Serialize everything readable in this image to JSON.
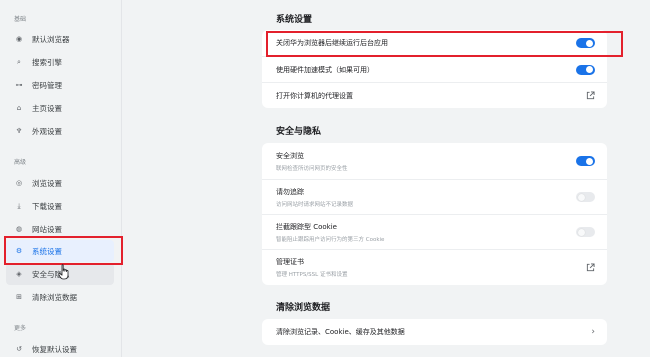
{
  "sidebar": {
    "sections": [
      {
        "label": "基础",
        "items": [
          {
            "icon": "chrome-logo-icon",
            "glyph": "◉",
            "label": "默认浏览器"
          },
          {
            "icon": "search-icon",
            "glyph": "⌕",
            "label": "搜索引擎"
          },
          {
            "icon": "key-icon",
            "glyph": "⊶",
            "label": "密码管理"
          },
          {
            "icon": "home-icon",
            "glyph": "⌂",
            "label": "主页设置"
          },
          {
            "icon": "brush-icon",
            "glyph": "♆",
            "label": "外观设置"
          }
        ]
      },
      {
        "label": "高级",
        "items": [
          {
            "icon": "eye-icon",
            "glyph": "◎",
            "label": "浏览设置"
          },
          {
            "icon": "download-icon",
            "glyph": "⤓",
            "label": "下载设置"
          },
          {
            "icon": "globe-icon",
            "glyph": "◍",
            "label": "网站设置"
          },
          {
            "icon": "gear-icon",
            "glyph": "⚙",
            "label": "系统设置"
          },
          {
            "icon": "shield-icon",
            "glyph": "◈",
            "label": "安全与隐私"
          },
          {
            "icon": "trash-icon",
            "glyph": "⊞",
            "label": "清除浏览数据"
          }
        ]
      },
      {
        "label": "更多",
        "items": [
          {
            "icon": "restore-icon",
            "glyph": "↺",
            "label": "恢复默认设置"
          }
        ]
      }
    ]
  },
  "main": {
    "system": {
      "title": "系统设置",
      "rows": [
        {
          "label": "关闭华为浏览器后继续运行后台应用",
          "toggle": "on"
        },
        {
          "label": "使用硬件加速模式（如果可用）",
          "toggle": "on"
        },
        {
          "label": "打开你计算机的代理设置",
          "action": "external-link-icon"
        }
      ]
    },
    "security": {
      "title": "安全与隐私",
      "rows": [
        {
          "label": "安全浏览",
          "sub": "联网检查所访问网页的安全性",
          "toggle": "on"
        },
        {
          "label": "请勿追踪",
          "sub": "访问网站时请求网站不记录数据",
          "toggle": "off"
        },
        {
          "label": "拦截跟踪型 Cookie",
          "sub": "智能阻止跟踪用户访问行为的第三方 Cookie",
          "toggle": "off"
        },
        {
          "label": "管理证书",
          "sub": "管理 HTTPS/SSL 证书和设置",
          "action": "external-link-icon"
        }
      ]
    },
    "clear": {
      "title": "清除浏览数据",
      "rows": [
        {
          "label": "清除浏览记录、Cookie、缓存及其他数据",
          "action": "chevron-right-icon"
        }
      ]
    }
  },
  "colors": {
    "accent": "#1a73e8",
    "highlight": "#e3202c"
  }
}
